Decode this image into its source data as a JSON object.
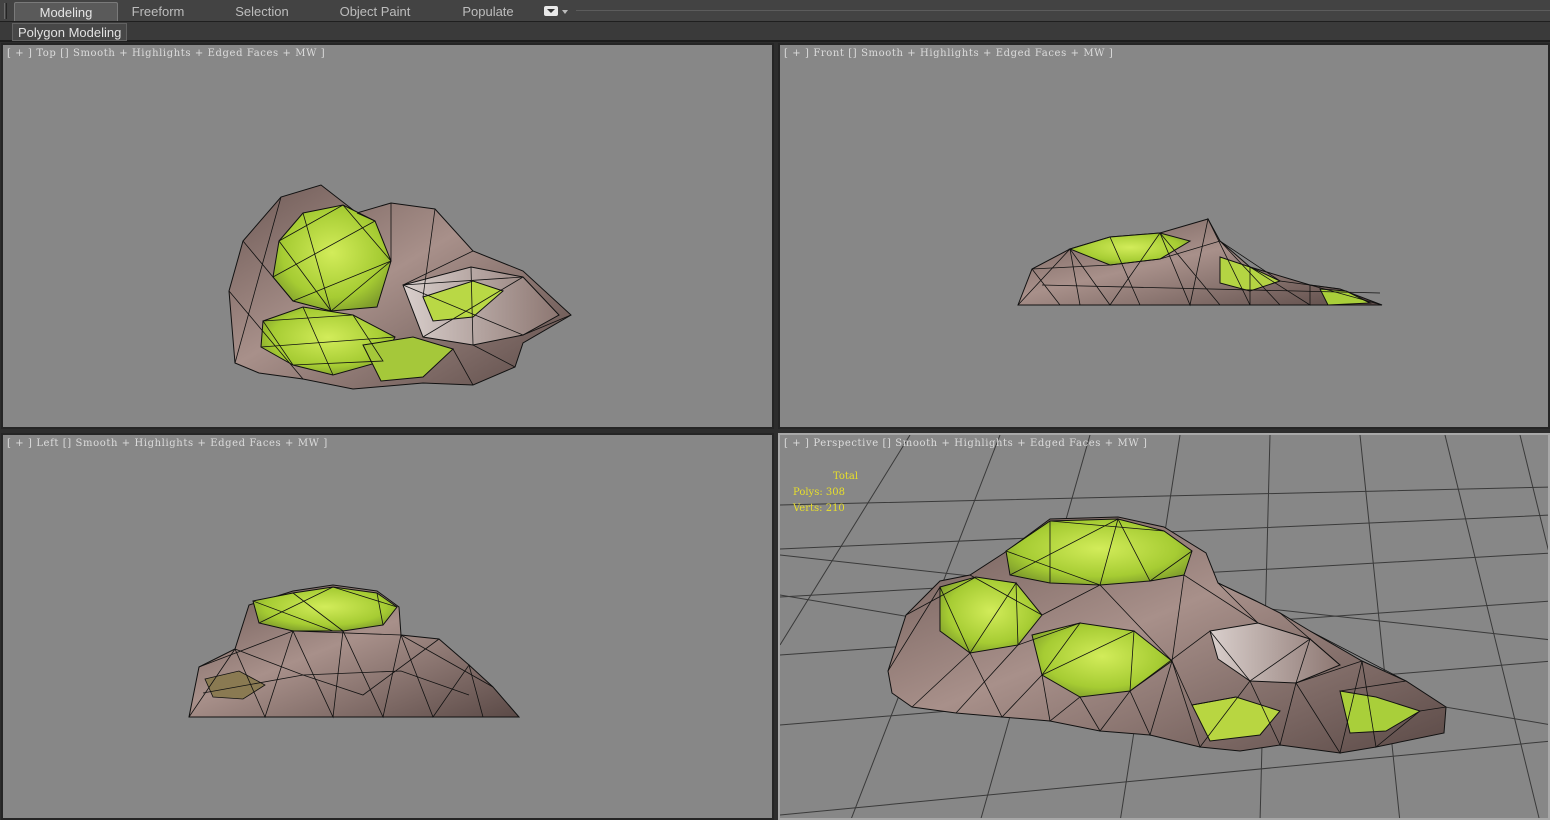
{
  "ribbon": {
    "tabs": [
      {
        "label": "Modeling",
        "active": true
      },
      {
        "label": "Freeform",
        "active": false
      },
      {
        "label": "Selection",
        "active": false
      },
      {
        "label": "Object Paint",
        "active": false
      },
      {
        "label": "Populate",
        "active": false
      }
    ],
    "menu_icon": "dropdown-menu-icon",
    "panel_label": "Polygon Modeling"
  },
  "viewports": {
    "top": {
      "label": "[ + ] Top [] Smooth + Highlights + Edged Faces + MW ]"
    },
    "front": {
      "label": "[ + ] Front [] Smooth + Highlights + Edged Faces + MW ]"
    },
    "left": {
      "label": "[ + ] Left [] Smooth + Highlights + Edged Faces + MW ]"
    },
    "perspective": {
      "label": "[ + ] Perspective [] Smooth + Highlights + Edged Faces + MW ]",
      "stats": {
        "title": "Total",
        "polys": "Polys: 308",
        "verts": "Verts: 210"
      }
    }
  },
  "colors": {
    "viewport_bg": "#878787",
    "rock": "#8c7874",
    "moss": "#a9cf3a",
    "stat_text": "#e8df2a"
  }
}
